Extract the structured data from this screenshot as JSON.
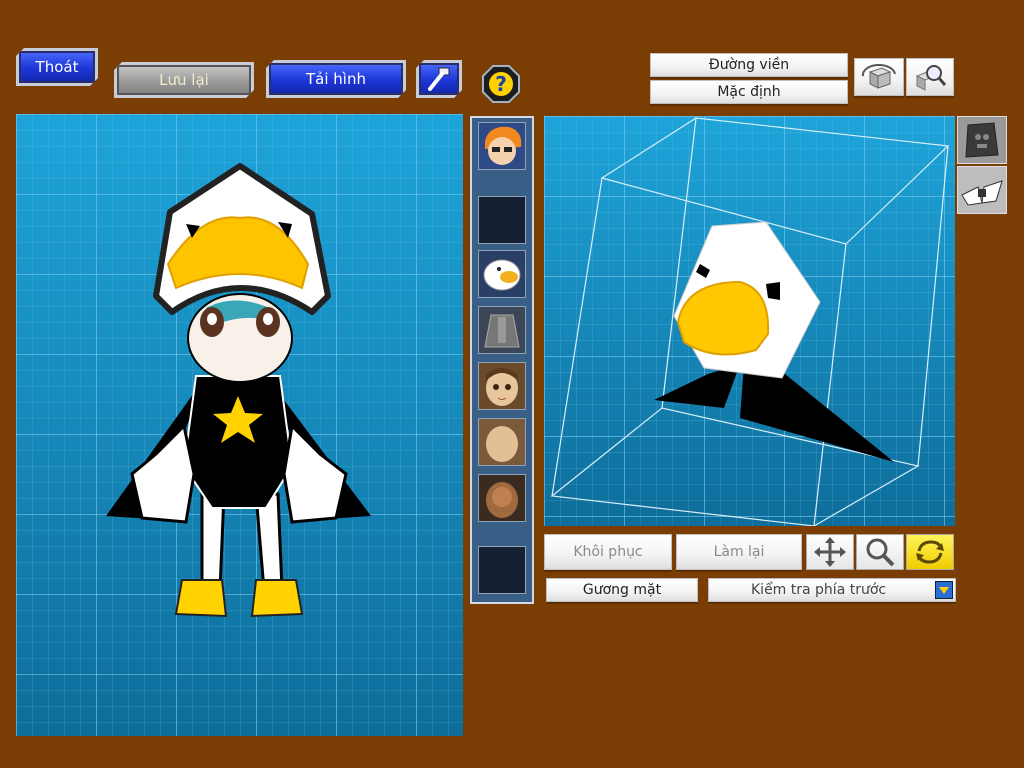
{
  "toolbar": {
    "exit_label": "Thoát",
    "save_label": "Lưu lại",
    "load_label": "Tải hình",
    "hammer_icon": "hammer-icon",
    "help_icon": "help-icon"
  },
  "view_options": {
    "outline_label": "Đường viền",
    "default_label": "Mặc định",
    "rotate_icon": "cube-rotate-icon",
    "zoom_icon": "cube-zoom-icon"
  },
  "side_tools": {
    "block_icon": "skull-block-icon",
    "wings_icon": "wings-icon"
  },
  "parts_strip": [
    "character-portrait-thumb",
    "empty-slot",
    "bird-hood-thumb",
    "body-armor-thumb",
    "face-thumb",
    "face-blank-thumb",
    "face-dark-thumb",
    "empty-slot"
  ],
  "editor_controls": {
    "restore_label": "Khôi phục",
    "redo_label": "Làm lại",
    "move_icon": "move-arrows-icon",
    "zoom_icon": "magnifier-icon",
    "rotate_icon": "rotate-arrows-icon"
  },
  "part_select": {
    "part_label": "Gương mặt",
    "view_value": "Kiểm tra phía trước"
  },
  "colors": {
    "background": "#7a3e04",
    "grid": "#1a93c7",
    "accent_yellow": "#ffd200"
  }
}
